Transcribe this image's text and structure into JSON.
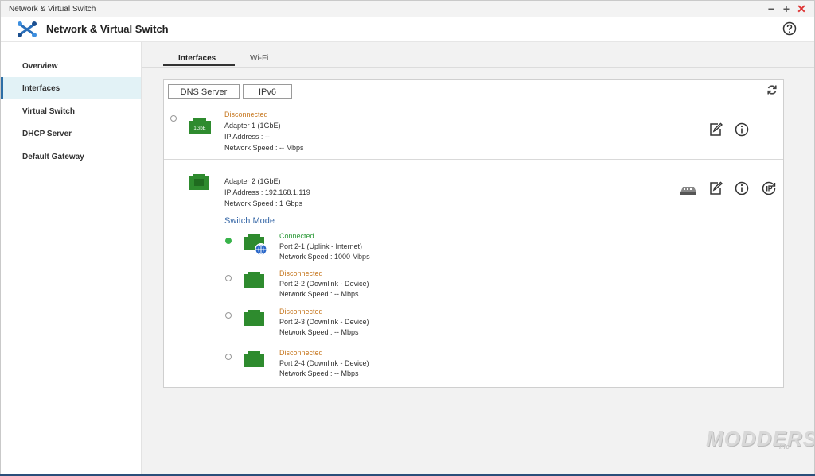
{
  "window": {
    "title": "Network & Virtual Switch"
  },
  "header": {
    "app_title": "Network & Virtual Switch"
  },
  "sidebar": {
    "items": [
      {
        "label": "Overview",
        "active": false
      },
      {
        "label": "Interfaces",
        "active": true
      },
      {
        "label": "Virtual Switch",
        "active": false
      },
      {
        "label": "DHCP Server",
        "active": false
      },
      {
        "label": "Default Gateway",
        "active": false
      }
    ]
  },
  "tabs": [
    {
      "label": "Interfaces",
      "active": true
    },
    {
      "label": "Wi-Fi",
      "active": false
    }
  ],
  "toolbar": {
    "dns_label": "DNS Server",
    "ipv6_label": "IPv6"
  },
  "adapter1": {
    "status": "Disconnected",
    "name": "Adapter 1 (1GbE)",
    "ip": "IP Address : --",
    "speed": "Network Speed : -- Mbps",
    "nic_badge": "1GbE"
  },
  "adapter2": {
    "name": "Adapter 2 (1GbE)",
    "ip": "IP Address : 192.168.1.119",
    "speed": "Network Speed : 1 Gbps",
    "switch_mode_label": "Switch Mode",
    "ports": [
      {
        "status": "Connected",
        "name": "Port 2-1 (Uplink - Internet)",
        "speed": "Network Speed : 1000 Mbps"
      },
      {
        "status": "Disconnected",
        "name": "Port 2-2 (Downlink - Device)",
        "speed": "Network Speed : -- Mbps"
      },
      {
        "status": "Disconnected",
        "name": "Port 2-3 (Downlink - Device)",
        "speed": "Network Speed : -- Mbps"
      },
      {
        "status": "Disconnected",
        "name": "Port 2-4 (Downlink - Device)",
        "speed": "Network Speed : -- Mbps"
      }
    ]
  },
  "watermark": {
    "text": "MODDERS",
    "sub": "inc"
  },
  "colors": {
    "accent": "#2c6ea6",
    "connected": "#2e9a3a",
    "disconnected": "#c6771f",
    "nic_green": "#2e8b2e",
    "active_nav_bg": "#e2f2f6"
  },
  "icons": {
    "app_logo": "network-switch-logo-icon",
    "help": "help-circle-icon",
    "refresh": "refresh-icon",
    "edit": "edit-icon",
    "info": "info-icon",
    "switch_device": "switch-device-icon",
    "ip_config": "ip-config-icon",
    "nic": "ethernet-port-icon",
    "globe": "globe-icon"
  }
}
